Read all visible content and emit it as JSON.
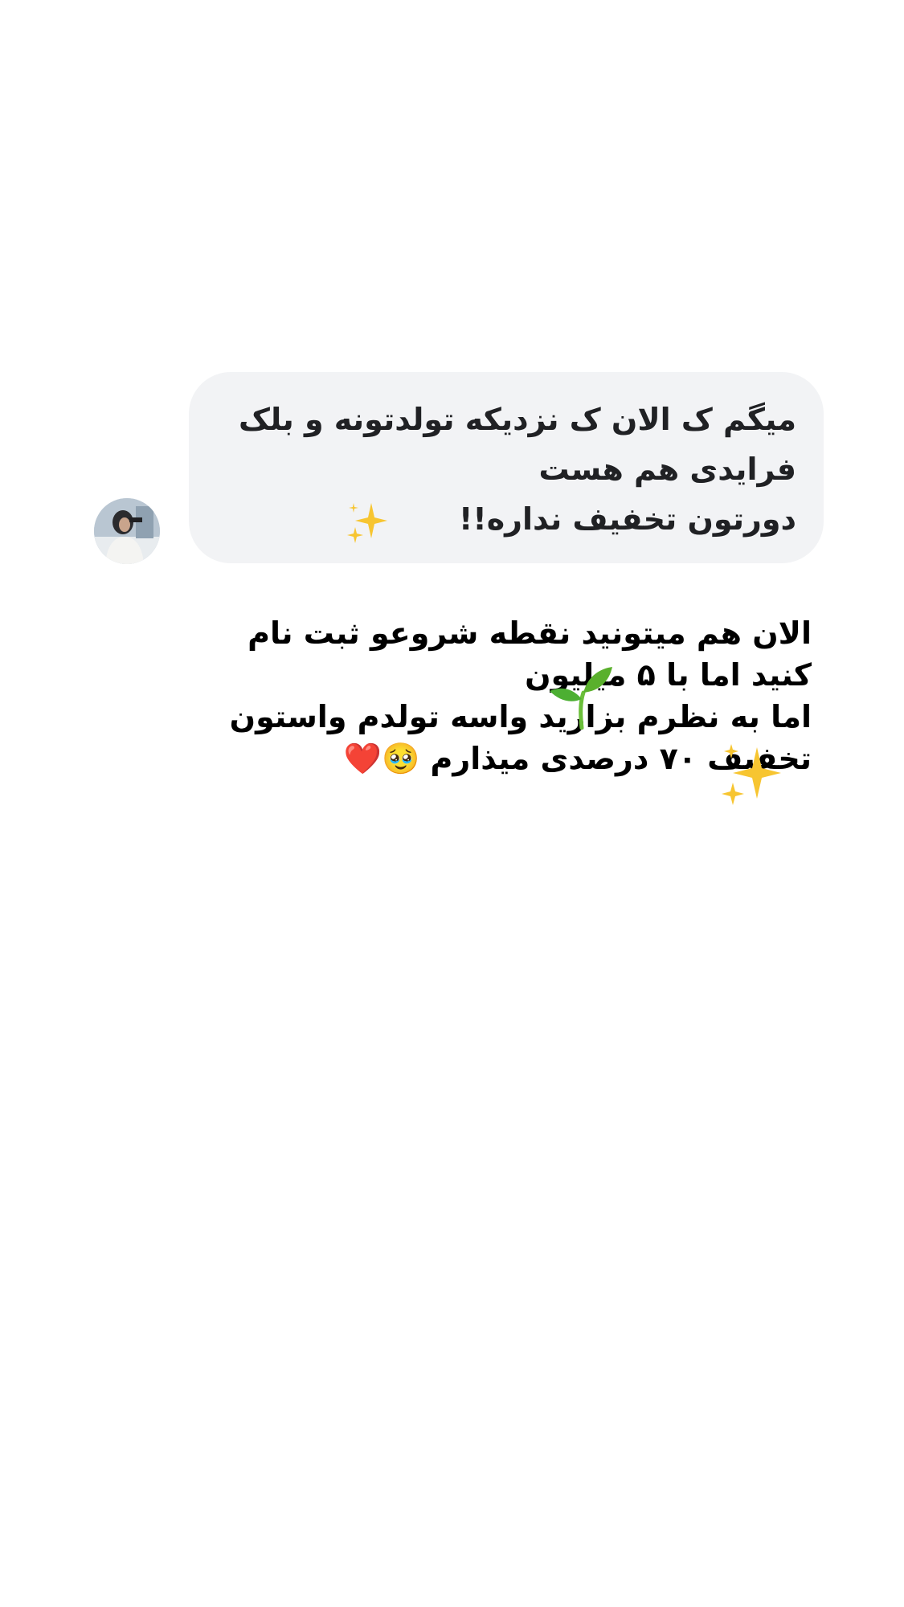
{
  "received_message": {
    "lines": [
      "میگم ک الان ک نزدیکه تولدتونه و بلک",
      "فرایدی هم هست",
      "دورتون تخفیف نداره!!"
    ]
  },
  "reply_message": {
    "lines": [
      "الان هم میتونید نقطه شروعو ثبت نام",
      "کنید اما با ۵ میلیون",
      "اما به نظرم بزارید واسه تولدم واستون",
      "تخفیف ۷۰ درصدی میذارم 🥹❤️"
    ]
  },
  "stickers": [
    "sparkles-icon",
    "seedling-icon",
    "sparkles-icon"
  ],
  "colors": {
    "bubble_bg": "#f2f3f5",
    "received_text": "#202124",
    "reply_text": "#000000",
    "sparkle": "#f7c531",
    "leaf": "#4caf32"
  }
}
